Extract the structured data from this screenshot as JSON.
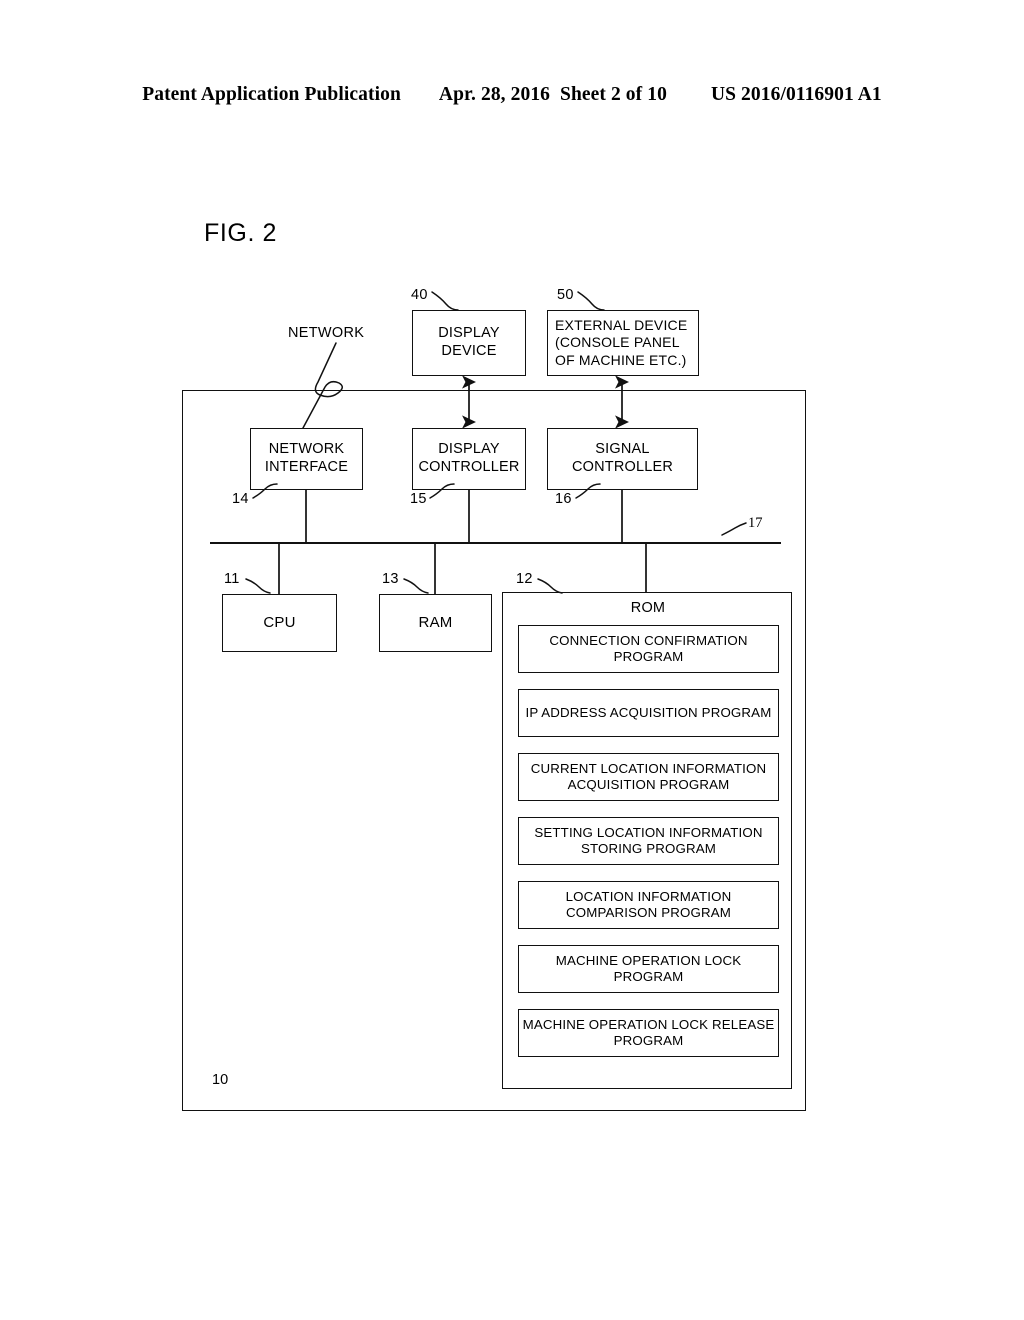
{
  "header": {
    "publication": "Patent Application Publication",
    "date": "Apr. 28, 2016",
    "sheet": "Sheet 2 of 10",
    "docnum": "US 2016/0116901 A1"
  },
  "figure": {
    "title": "FIG. 2",
    "network_label": "NETWORK",
    "system_ref": "10",
    "bus_ref": "17"
  },
  "boxes": {
    "display_device": {
      "line1": "DISPLAY",
      "line2": "DEVICE",
      "ref": "40"
    },
    "external_device": {
      "line1": "EXTERNAL DEVICE",
      "line2": "(CONSOLE PANEL",
      "line3": "OF MACHINE ETC.)",
      "ref": "50"
    },
    "network_interface": {
      "line1": "NETWORK",
      "line2": "INTERFACE",
      "ref": "14"
    },
    "display_controller": {
      "line1": "DISPLAY",
      "line2": "CONTROLLER",
      "ref": "15"
    },
    "signal_controller": {
      "line1": "SIGNAL",
      "line2": "CONTROLLER",
      "ref": "16"
    },
    "cpu": {
      "label": "CPU",
      "ref": "11"
    },
    "ram": {
      "label": "RAM",
      "ref": "13"
    },
    "rom": {
      "label": "ROM",
      "ref": "12"
    }
  },
  "programs": [
    {
      "line1": "CONNECTION CONFIRMATION",
      "line2": "PROGRAM"
    },
    {
      "line1": "IP ADDRESS ACQUISITION",
      "line2": "PROGRAM"
    },
    {
      "line1": "CURRENT LOCATION INFORMATION",
      "line2": "ACQUISITION PROGRAM"
    },
    {
      "line1": "SETTING LOCATION INFORMATION",
      "line2": "STORING PROGRAM"
    },
    {
      "line1": "LOCATION INFORMATION",
      "line2": "COMPARISON PROGRAM"
    },
    {
      "line1": "MACHINE OPERATION LOCK",
      "line2": "PROGRAM"
    },
    {
      "line1": "MACHINE OPERATION LOCK",
      "line2": "RELEASE PROGRAM"
    }
  ],
  "colors": {
    "ink": "#111111",
    "paper": "#ffffff"
  }
}
